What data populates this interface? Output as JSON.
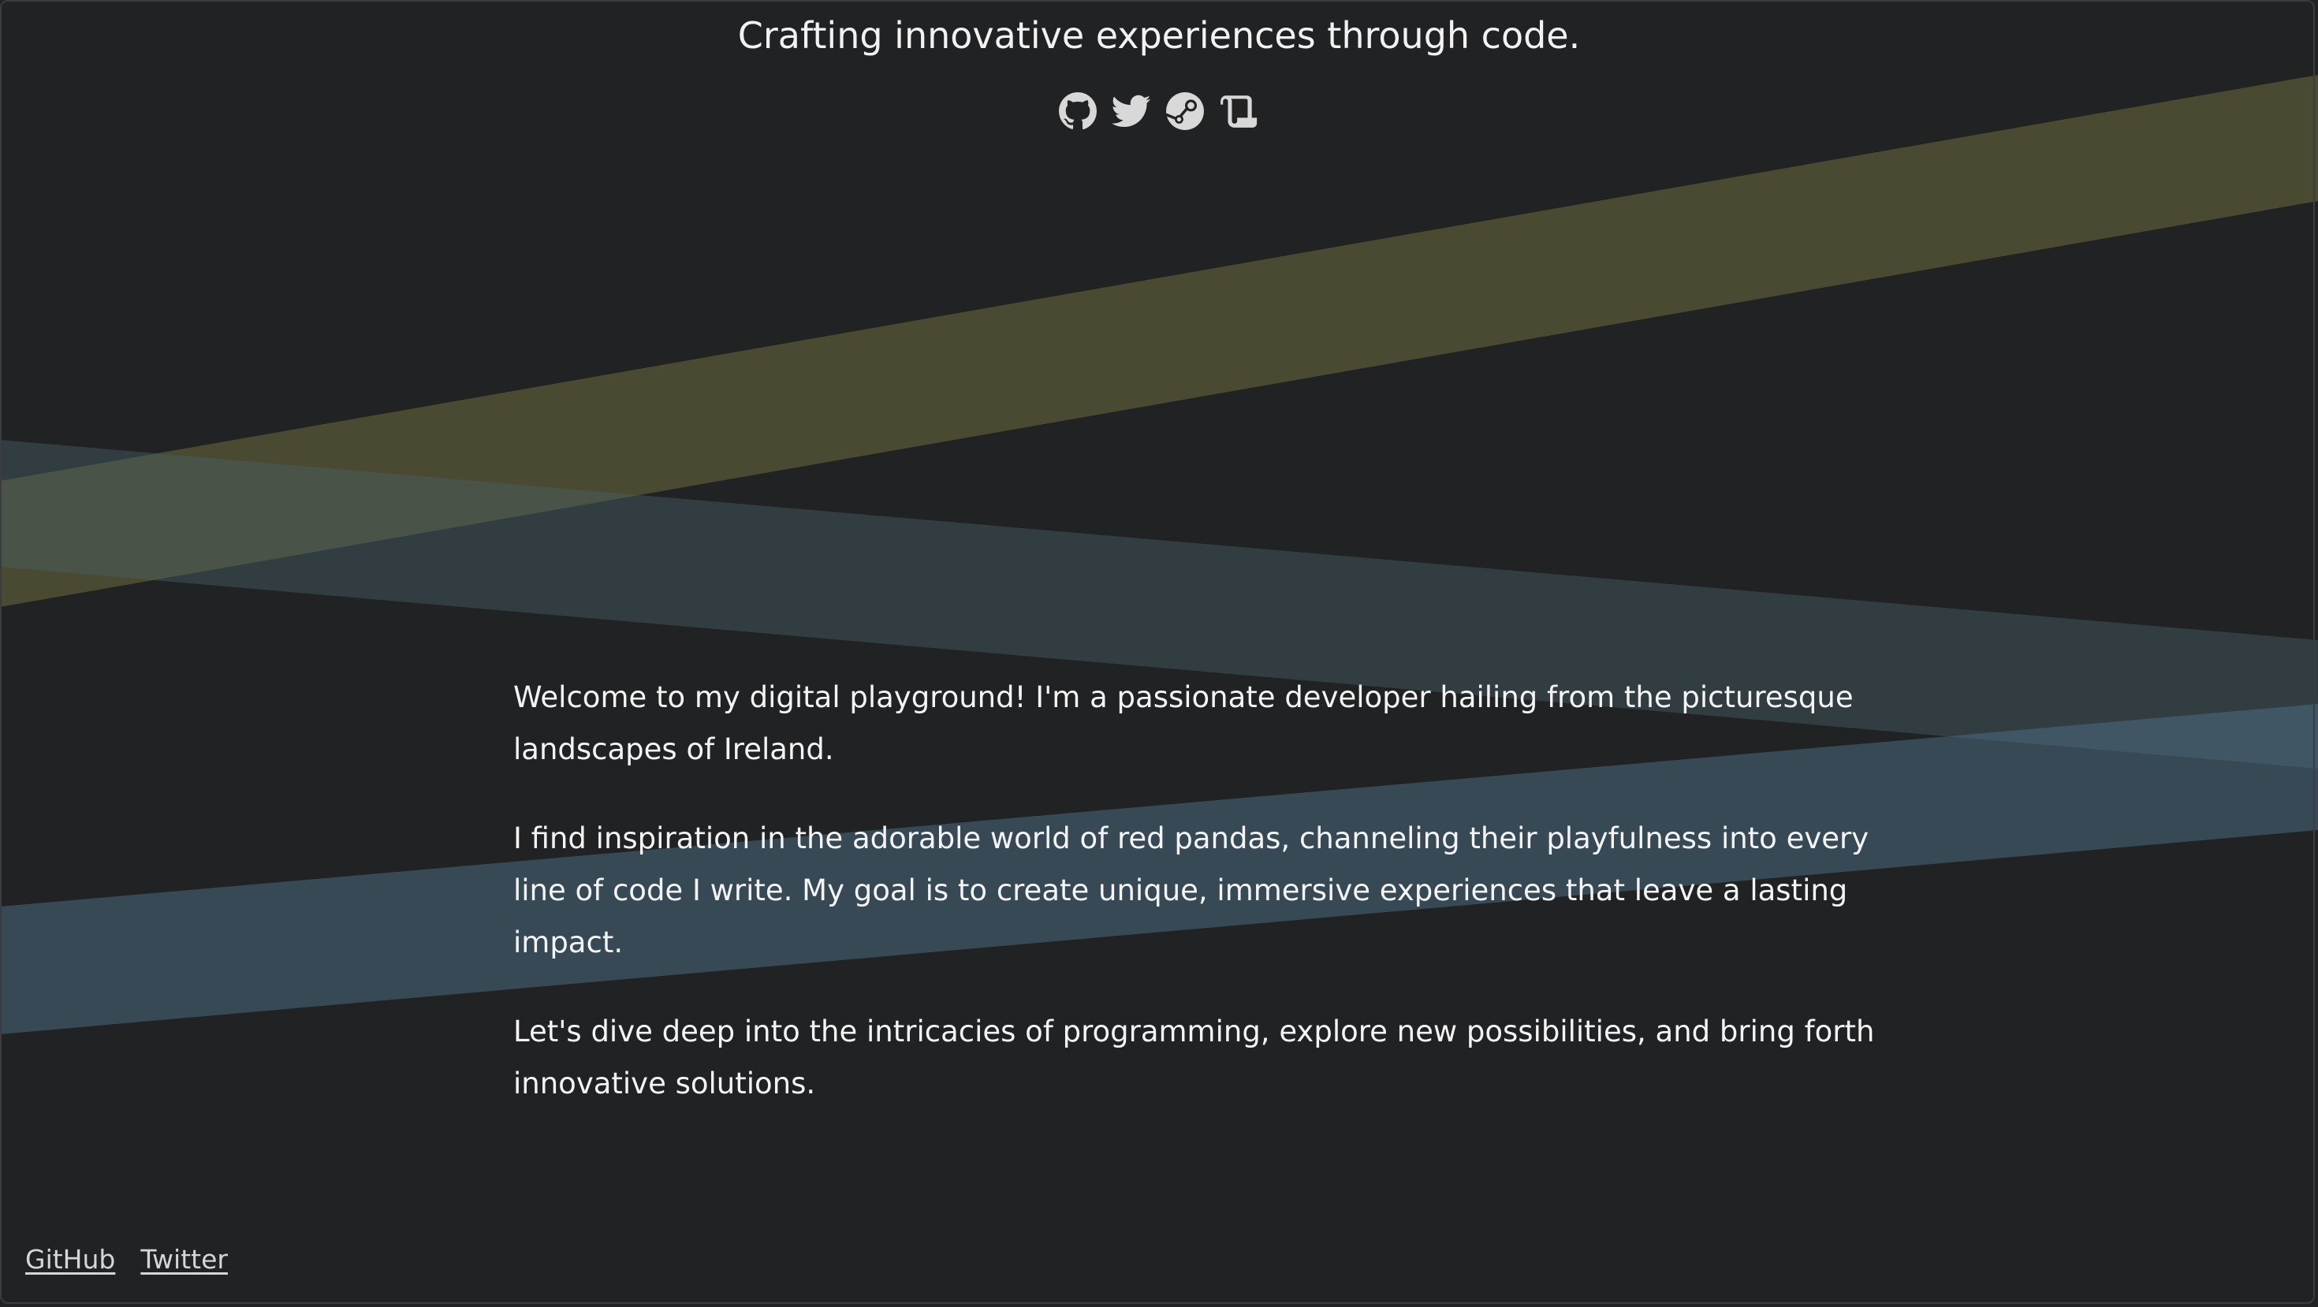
{
  "header": {
    "tagline": "Crafting innovative experiences through code."
  },
  "social_icons": [
    {
      "icon": "github-icon"
    },
    {
      "icon": "twitter-icon"
    },
    {
      "icon": "steam-icon"
    },
    {
      "icon": "scroll-icon"
    }
  ],
  "content": {
    "paragraphs": [
      "Welcome to my digital playground! I'm a passionate developer hailing from the picturesque landscapes of Ireland.",
      "I find inspiration in the adorable world of red pandas, channeling their playfulness into every line of code I write. My goal is to create unique, immersive experiences that leave a lasting impact.",
      "Let's dive deep into the intricacies of programming, explore new possibilities, and bring forth innovative solutions."
    ]
  },
  "footer": {
    "links": [
      "GitHub",
      "Twitter"
    ]
  },
  "colors": {
    "background": "#202224",
    "band_olive": "#6e6a3c",
    "band_slate": "#4a5f66",
    "band_blue": "#4f6f87",
    "text": "#f4f4f4",
    "icon": "#d8d8d8"
  }
}
